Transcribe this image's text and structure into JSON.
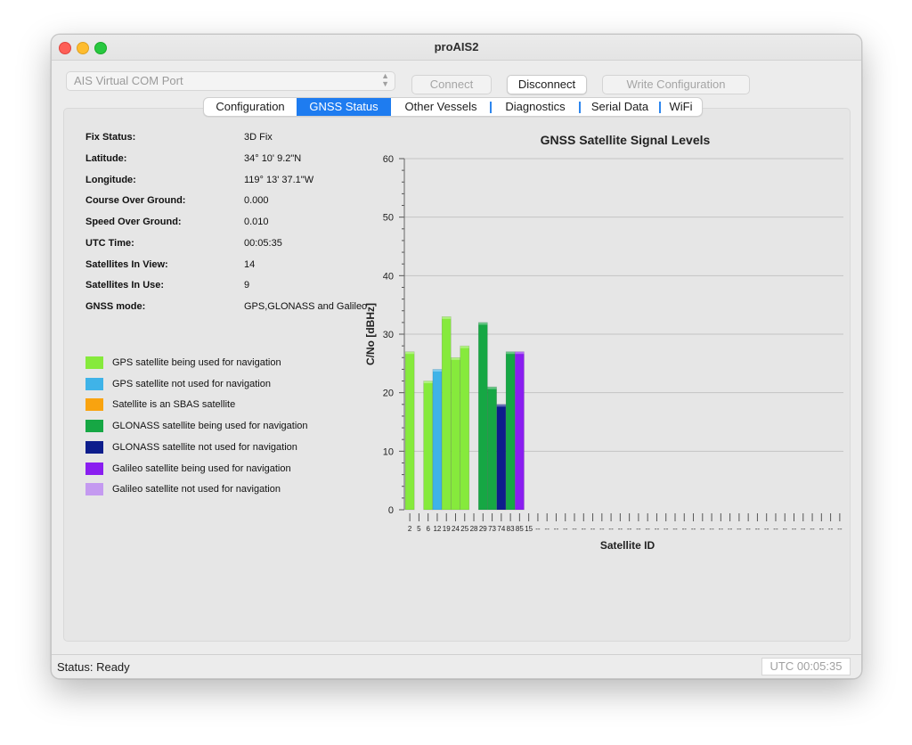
{
  "window": {
    "title": "proAIS2"
  },
  "toolbar": {
    "port_value": "AIS Virtual COM Port",
    "connect_label": "Connect",
    "disconnect_label": "Disconnect",
    "write_config_label": "Write Configuration"
  },
  "tabs": [
    {
      "label": "Configuration",
      "active": false
    },
    {
      "label": "GNSS Status",
      "active": true
    },
    {
      "label": "Other Vessels",
      "active": false
    },
    {
      "label": "Diagnostics",
      "active": false
    },
    {
      "label": "Serial Data",
      "active": false
    },
    {
      "label": "WiFi",
      "active": false
    }
  ],
  "gnss": {
    "fields": [
      {
        "label": "Fix Status:",
        "value": "3D Fix"
      },
      {
        "label": "Latitude:",
        "value": "34° 10' 9.2\"N"
      },
      {
        "label": "Longitude:",
        "value": "119° 13' 37.1\"W"
      },
      {
        "label": "Course Over Ground:",
        "value": "0.000"
      },
      {
        "label": "Speed Over Ground:",
        "value": "0.010"
      },
      {
        "label": "UTC Time:",
        "value": "00:05:35"
      },
      {
        "label": "Satellites In View:",
        "value": "14"
      },
      {
        "label": "Satellites In Use:",
        "value": "9"
      },
      {
        "label": "GNSS mode:",
        "value": "GPS,GLONASS and Galileo"
      }
    ],
    "legend": [
      {
        "label": "GPS satellite being used for navigation",
        "color": "#86ea3c"
      },
      {
        "label": "GPS satellite not used for navigation",
        "color": "#3fb3e8"
      },
      {
        "label": "Satellite is an SBAS satellite",
        "color": "#f9a30f"
      },
      {
        "label": "GLONASS satellite being used for navigation",
        "color": "#16a744"
      },
      {
        "label": "GLONASS satellite not used for navigation",
        "color": "#0d1d8c"
      },
      {
        "label": "Galileo satellite being used for navigation",
        "color": "#8a1ef0"
      },
      {
        "label": "Galileo satellite not used for navigation",
        "color": "#c49af0"
      }
    ]
  },
  "chart_data": {
    "type": "bar",
    "title": "GNSS Satellite Signal Levels",
    "xlabel": "Satellite ID",
    "ylabel": "C/No [dBHz]",
    "ylim": [
      0,
      60
    ],
    "yticks": [
      0,
      10,
      20,
      30,
      40,
      50,
      60
    ],
    "grid": true,
    "slot_count": 48,
    "empty_slot_label": "--",
    "bars": [
      {
        "id": "2",
        "value": 27,
        "color": "#86ea3c"
      },
      {
        "id": "5",
        "value": 0,
        "color": "#86ea3c"
      },
      {
        "id": "6",
        "value": 22,
        "color": "#86ea3c"
      },
      {
        "id": "12",
        "value": 24,
        "color": "#3fb3e8"
      },
      {
        "id": "19",
        "value": 33,
        "color": "#86ea3c"
      },
      {
        "id": "24",
        "value": 26,
        "color": "#86ea3c"
      },
      {
        "id": "25",
        "value": 28,
        "color": "#86ea3c"
      },
      {
        "id": "28",
        "value": 0,
        "color": "#86ea3c"
      },
      {
        "id": "29",
        "value": 32,
        "color": "#16a744"
      },
      {
        "id": "73",
        "value": 21,
        "color": "#16a744"
      },
      {
        "id": "74",
        "value": 18,
        "color": "#0d1d8c"
      },
      {
        "id": "83",
        "value": 27,
        "color": "#16a744"
      },
      {
        "id": "85",
        "value": 27,
        "color": "#8a1ef0"
      },
      {
        "id": "15",
        "value": 0,
        "color": "#8a1ef0"
      }
    ]
  },
  "status": {
    "text": "Status: Ready",
    "utc": "UTC  00:05:35"
  }
}
